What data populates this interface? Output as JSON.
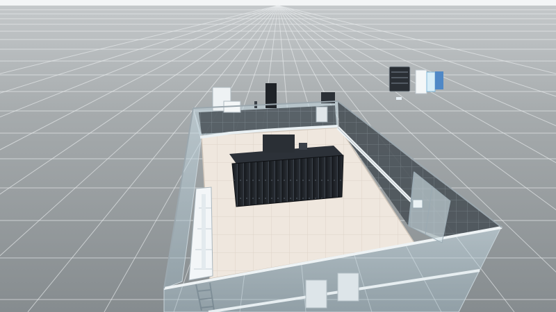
{
  "viewport": {
    "scene": "3d-data-center-room",
    "colors": {
      "sky_top": "#f2f4f5",
      "ground_far": "#b9bdbf",
      "ground_near": "#8e9496",
      "grid_line": "#e6e9ea",
      "glass": "#d7e6ec",
      "floor_tile": "#efe8df",
      "rack": "#1c1f24",
      "equipment_light": "#f4f6f8",
      "accent_blue": "#5aa8e6"
    }
  }
}
